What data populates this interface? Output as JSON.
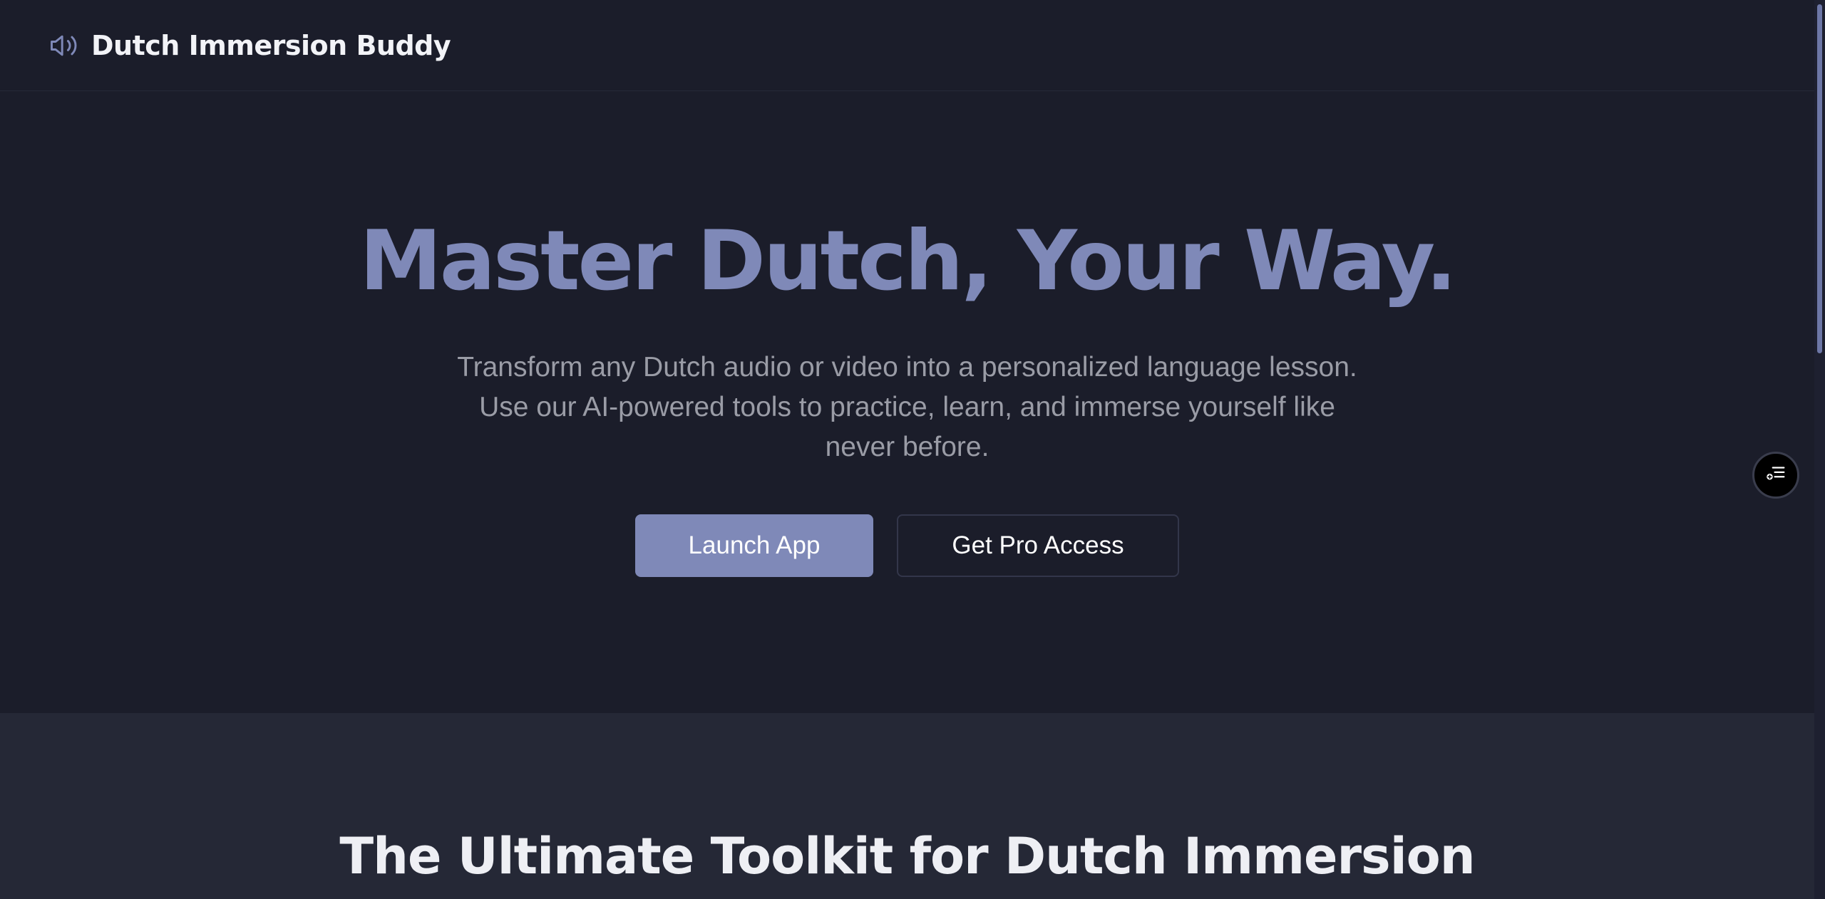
{
  "header": {
    "brand_name": "Dutch Immersion Buddy",
    "brand_icon": "speaker-icon"
  },
  "hero": {
    "title": "Master Dutch, Your Way.",
    "subtitle": "Transform any Dutch audio or video into a personalized language lesson. Use our AI-powered tools to practice, learn, and immerse yourself like never before.",
    "primary_button": "Launch App",
    "secondary_button": "Get Pro Access"
  },
  "toolkit": {
    "title": "The Ultimate Toolkit for Dutch Immersion"
  },
  "floating_button": {
    "icon": "reader-list-icon"
  },
  "colors": {
    "background": "#1b1d2a",
    "accent": "#7f89b8",
    "section_background": "#252836",
    "muted_text": "#9a9ca6"
  }
}
